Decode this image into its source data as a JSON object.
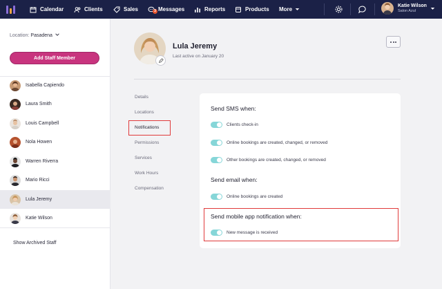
{
  "nav": {
    "items": [
      {
        "label": "Calendar",
        "icon": "calendar-icon"
      },
      {
        "label": "Clients",
        "icon": "users-icon"
      },
      {
        "label": "Sales",
        "icon": "tag-icon"
      },
      {
        "label": "Messages",
        "icon": "chat-icon",
        "badge": "3"
      },
      {
        "label": "Reports",
        "icon": "bar-chart-icon"
      },
      {
        "label": "Products",
        "icon": "box-icon"
      },
      {
        "label": "More",
        "icon": "chevron-down-icon"
      }
    ],
    "user_name": "Katie Wilson",
    "user_salon": "Salon Azul"
  },
  "sidebar": {
    "location_label": "Location:",
    "location_value": "Pasadena",
    "add_button": "Add Staff Member",
    "staff": [
      "Isabella Capiendo",
      "Laura Smith",
      "Louis Campbell",
      "Nola Howen",
      "Warren Riverra",
      "Mario Ricci",
      "Lula Jeremy",
      "Katie Wilson"
    ],
    "active_staff": "Lula Jeremy",
    "show_archived": "Show Archived Staff"
  },
  "profile": {
    "name": "Lula Jeremy",
    "last_active": "Last active on January 20"
  },
  "tabs": [
    "Details",
    "Locations",
    "Notifications",
    "Permissions",
    "Services",
    "Work Hours",
    "Compensation"
  ],
  "active_tab": "Notifications",
  "notifications": {
    "sms_title": "Send SMS when:",
    "sms_items": [
      "Clients check-in",
      "Online bookings are created, changed, or removed",
      "Other bookings are created, changed, or removed"
    ],
    "email_title": "Send email when:",
    "email_items": [
      "Online bookings are created"
    ],
    "mobile_title": "Send mobile app notification when:",
    "mobile_items": [
      "New message is received"
    ]
  },
  "colors": {
    "nav_bg": "#1b2147",
    "accent_pink": "#c8347e",
    "toggle_on": "#86d6d8",
    "highlight_red": "#e0393a"
  }
}
